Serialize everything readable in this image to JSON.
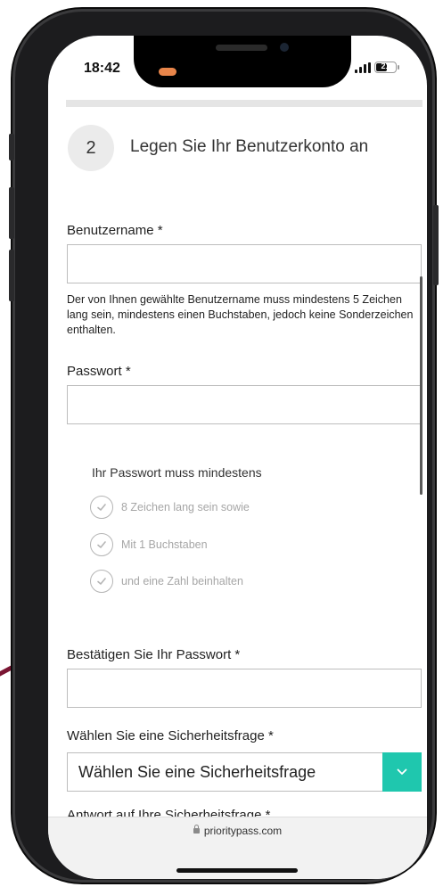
{
  "status": {
    "time": "18:42",
    "battery": "21"
  },
  "step": {
    "number": "2",
    "title": "Legen Sie Ihr Benutzerkonto an"
  },
  "username": {
    "label": "Benutzername *",
    "value": "",
    "help": "Der von Ihnen gewählte Benutzername muss mindestens 5 Zeichen lang sein, mindestens einen Buchstaben, jedoch keine Sonderzeichen enthalten."
  },
  "password": {
    "label": "Passwort *",
    "value": ""
  },
  "password_rules": {
    "title": "Ihr Passwort muss mindestens",
    "items": [
      "8 Zeichen lang sein sowie",
      "Mit 1 Buchstaben",
      "und eine Zahl beinhalten"
    ]
  },
  "confirm_password": {
    "label": "Bestätigen Sie Ihr Passwort *",
    "value": ""
  },
  "security_question": {
    "label": "Wählen Sie eine Sicherheitsfrage *",
    "selected": "Wählen Sie eine Sicherheitsfrage"
  },
  "answer": {
    "label": "Antwort auf Ihre Sicherheitsfrage *"
  },
  "browser": {
    "url": "prioritypass.com"
  },
  "colors": {
    "accent": "#1fc7ae",
    "deco_line": "#7a1533"
  }
}
